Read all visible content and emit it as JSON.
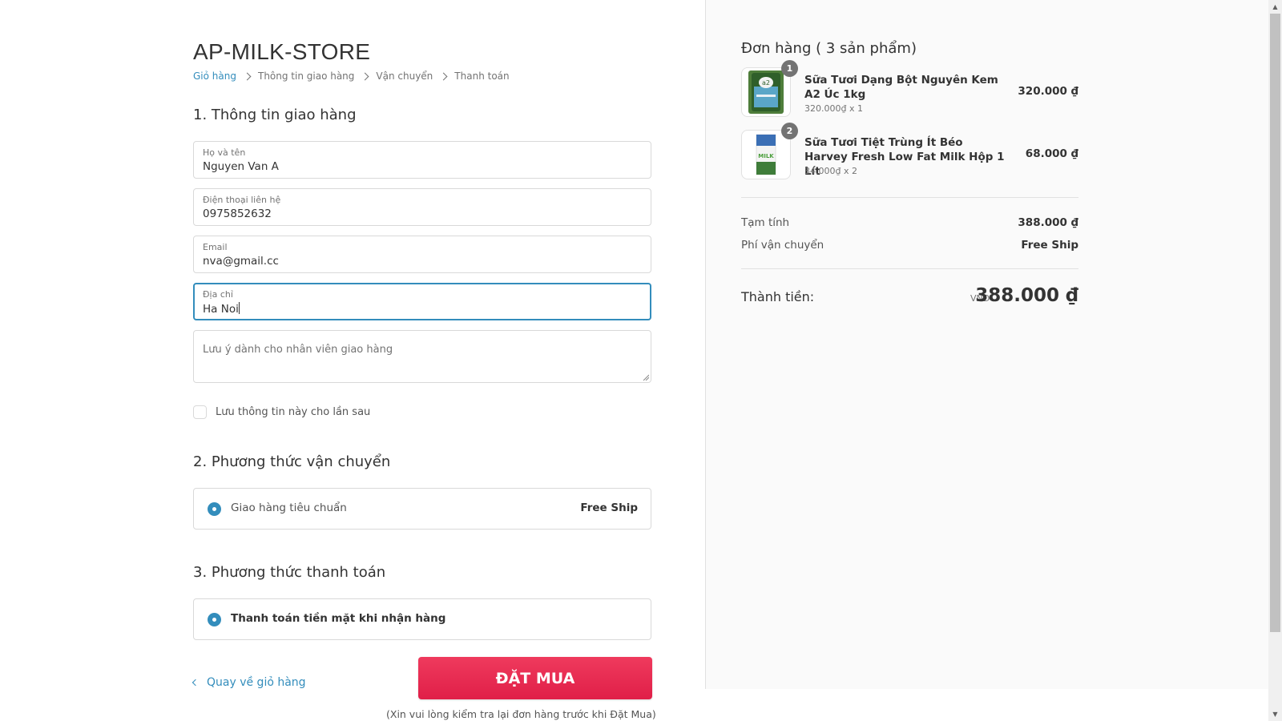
{
  "store": {
    "name": "AP-MILK-STORE"
  },
  "breadcrumb": [
    "Giỏ hàng",
    "Thông tin giao hàng",
    "Vận chuyển",
    "Thanh toán"
  ],
  "shipping_info": {
    "title": "1. Thông tin giao hàng",
    "full_name": {
      "label": "Họ và tên",
      "value": "Nguyen Van A"
    },
    "phone": {
      "label": "Điện thoại liên hệ",
      "value": "0975852632"
    },
    "email": {
      "label": "Email",
      "value": "nva@gmail.cc"
    },
    "address": {
      "label": "Địa chỉ",
      "value": "Ha Noi"
    },
    "note": {
      "placeholder": "Lưu ý dành cho nhân viên giao hàng"
    },
    "save_info_label": "Lưu thông tin này cho lần sau"
  },
  "shipping_method": {
    "title": "2. Phương thức vận chuyển",
    "option_label": "Giao hàng tiêu chuẩn",
    "option_price": "Free Ship"
  },
  "payment_method": {
    "title": "3. Phương thức thanh toán",
    "option_label": "Thanh toán tiền mặt khi nhận hàng"
  },
  "actions": {
    "back_label": "Quay về giỏ hàng",
    "order_label": "ĐẶT MUA",
    "order_note": "(Xin vui lòng kiểm tra lại đơn hàng trước khi Đặt Mua)"
  },
  "order": {
    "title": "Đơn hàng ( 3 sản phẩm)",
    "products": [
      {
        "qty_badge": "1",
        "name": "Sữa Tươi Dạng Bột Nguyên Kem A2 Úc 1kg",
        "unit_line": "320.000₫ x 1",
        "price": "320.000 ₫"
      },
      {
        "qty_badge": "2",
        "name": "Sữa Tươi Tiệt Trùng Ít Béo Harvey Fresh Low Fat Milk Hộp 1 Lít",
        "unit_line": "34.000₫ x 2",
        "price": "68.000 ₫"
      }
    ],
    "subtotal_label": "Tạm tính",
    "subtotal_value": "388.000 ₫",
    "shipping_fee_label": "Phí vận chuyển",
    "shipping_fee_value": "Free Ship",
    "total_label": "Thành tiền:",
    "total_currency": "VNĐ",
    "total_value": "388.000 ₫"
  },
  "colors": {
    "accent": "#338dbc",
    "order_button": "#e8264f",
    "panel_bg": "#fafafa"
  },
  "icons": [
    "chevron-right-icon",
    "chevron-left-icon",
    "radio-selected-icon",
    "checkbox-icon",
    "resize-handle-icon"
  ]
}
